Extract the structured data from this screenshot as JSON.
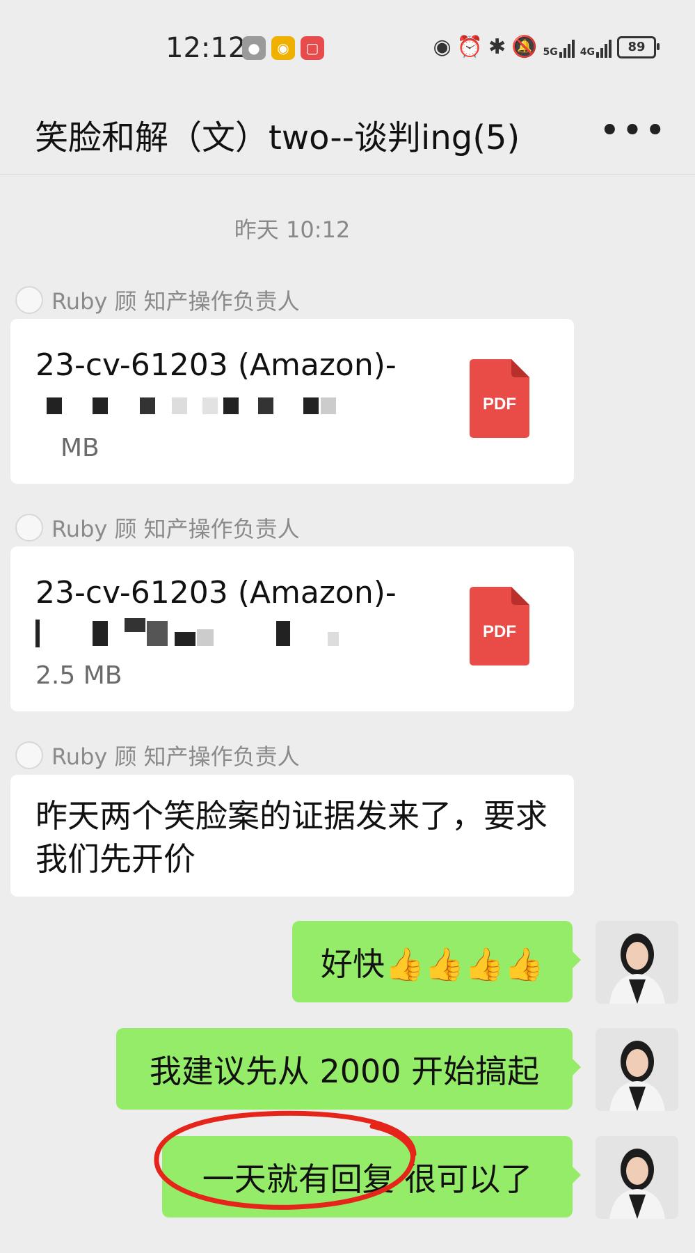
{
  "status_bar": {
    "time": "12:12",
    "signal1_label": "5G",
    "signal2_label": "4G",
    "battery": "89"
  },
  "header": {
    "title": "笑脸和解（文）two--谈判ing(5)",
    "more_icon": "more-dots-icon"
  },
  "chat": {
    "timestamp": "昨天 10:12",
    "messages": [
      {
        "sender": "Ruby 顾 知产操作负责人",
        "type": "file",
        "file_name_line1": "23-cv-61203 (Amazon)-",
        "file_name_line2_suffix": ".pdf",
        "file_size": "MB",
        "file_icon_label": "PDF"
      },
      {
        "sender": "Ruby 顾 知产操作负责人",
        "type": "file",
        "file_name_line1": "23-cv-61203 (Amazon)-",
        "file_name_line2_suffix": "df",
        "file_size": "2.5 MB",
        "file_icon_label": "PDF"
      },
      {
        "sender": "Ruby 顾 知产操作负责人",
        "type": "text",
        "text": "昨天两个笑脸案的证据发来了，要求我们先开价"
      }
    ],
    "my_messages": [
      {
        "text": "好快👍👍👍👍"
      },
      {
        "text": "我建议先从 2000 开始搞起"
      },
      {
        "text": "一天就有回复 很可以了"
      }
    ]
  },
  "colors": {
    "background": "#ededed",
    "my_bubble": "#95ec69",
    "other_bubble": "#ffffff",
    "pdf_red": "#e94b46",
    "annotation_red": "#e5241a"
  }
}
